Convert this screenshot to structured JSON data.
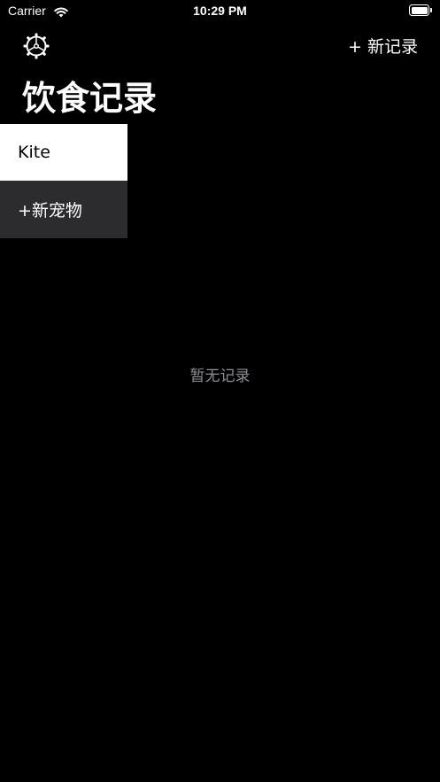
{
  "status_bar": {
    "carrier": "Carrier",
    "time": "10:29 PM",
    "wifi_icon": "wifi-icon",
    "battery_icon": "battery-icon"
  },
  "nav": {
    "settings_icon": "gear-icon",
    "new_record_label": "+ 新记录"
  },
  "page_title": "饮食记录",
  "pets": [
    {
      "name": "Kite",
      "selected": true
    }
  ],
  "add_pet_label": "+新宠物",
  "empty_text": "暂无记录",
  "colors": {
    "background": "#000000",
    "selected_bg": "#ffffff",
    "add_pet_bg": "#2c2c2e",
    "empty_text": "#8e8e93"
  }
}
